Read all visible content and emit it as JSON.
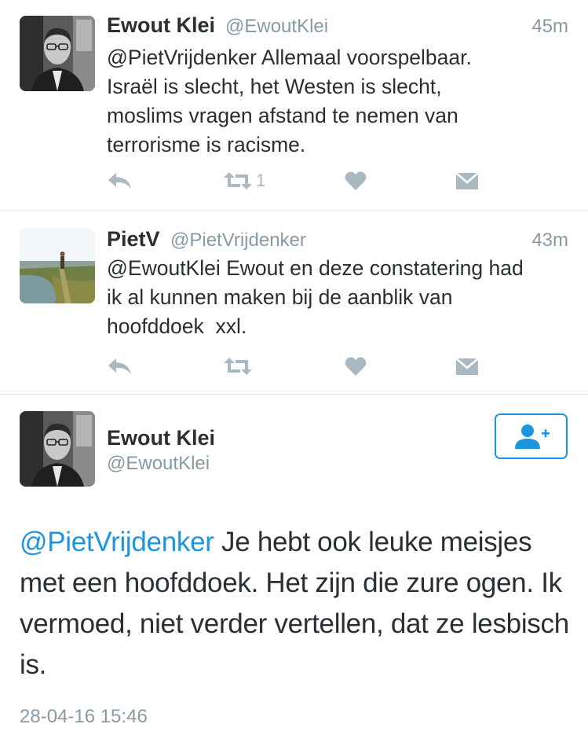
{
  "tweets": [
    {
      "name": "Ewout Klei",
      "handle": "@EwoutKlei",
      "time": "45m",
      "text": "@PietVrijdenker Allemaal voorspelbaar.\nIsraël is slecht, het Westen is slecht,\nmoslims vragen afstand te nemen van\nterrorisme is racisme.",
      "retweet_count": "1",
      "avatar": "man-with-glasses-avatar"
    },
    {
      "name": "PietV",
      "handle": "@PietVrijdenker",
      "time": "43m",
      "text": "@EwoutKlei Ewout en deze constatering had\nik al kunnen maken bij de aanblik van\nhoofddoek  xxl.",
      "retweet_count": "",
      "avatar": "landscape-avatar"
    }
  ],
  "main_tweet": {
    "name": "Ewout Klei",
    "handle": "@EwoutKlei",
    "mention": "@PietVrijdenker",
    "body": " Je hebt ook leuke meisjes met een hoofddoek. Het zijn die zure ogen. Ik vermoed, niet verder vertellen, dat ze lesbisch is.",
    "timestamp": "28-04-16 15:46"
  },
  "icons": {
    "reply": "reply-icon",
    "retweet": "retweet-icon",
    "like": "heart-icon",
    "dm": "envelope-icon",
    "follow": "follow-user-icon"
  },
  "colors": {
    "accent": "#1b95e0",
    "icon_gray": "#aab8c2",
    "meta_gray": "#8899a6",
    "text": "#292f33",
    "divider": "#e1e8ed"
  }
}
